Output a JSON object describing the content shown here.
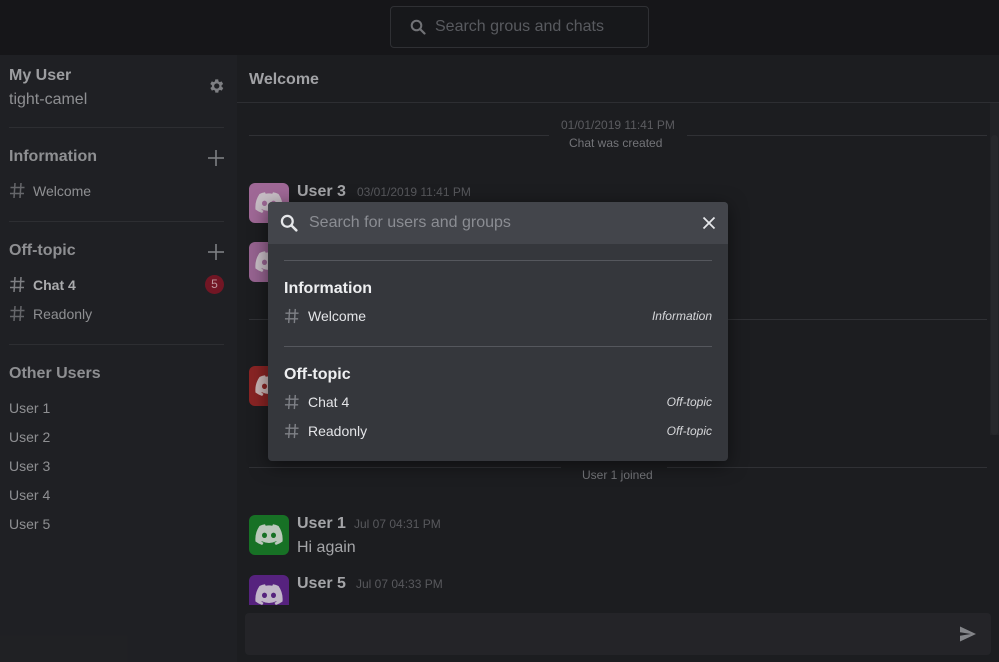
{
  "topbar": {
    "search_placeholder": "Search grous and chats"
  },
  "sidebar": {
    "user_title": "My User",
    "user_name": "tight-camel",
    "groups": [
      {
        "title": "Information",
        "channels": [
          {
            "label": "Welcome"
          }
        ]
      },
      {
        "title": "Off-topic",
        "channels": [
          {
            "label": "Chat 4",
            "unread": "5"
          },
          {
            "label": "Readonly"
          }
        ]
      }
    ],
    "other_users_title": "Other Users",
    "other_users": [
      "User 1",
      "User 2",
      "User 3",
      "User 4",
      "User 5"
    ]
  },
  "main": {
    "title": "Welcome",
    "system_events": [
      {
        "time": "01/01/2019 11:41 PM",
        "text": "Chat was created"
      },
      {
        "text": "User 1 joined"
      }
    ],
    "messages": [
      {
        "user": "User 3",
        "time": "03/01/2019 11:41 PM",
        "avatar_color": "#c27fb8"
      },
      {
        "avatar_color": "#b879b0"
      },
      {
        "avatar_color": "#a82c2c"
      },
      {
        "user": "User 1",
        "time": "Jul 07 04:31 PM",
        "text": "Hi again",
        "avatar_color": "#1d8a2e"
      },
      {
        "user": "User 5",
        "time": "Jul 07 04:33 PM",
        "avatar_color": "#6a2a9a"
      }
    ]
  },
  "modal": {
    "search_placeholder": "Search for users and groups",
    "groups": [
      {
        "title": "Information",
        "items": [
          {
            "label": "Welcome",
            "group": "Information"
          }
        ]
      },
      {
        "title": "Off-topic",
        "items": [
          {
            "label": "Chat 4",
            "group": "Off-topic"
          },
          {
            "label": "Readonly",
            "group": "Off-topic"
          }
        ]
      }
    ]
  },
  "icons": {
    "search": "search-icon",
    "gear": "gear-icon",
    "plus": "plus-icon",
    "hash": "hash-icon",
    "close": "close-icon",
    "send": "send-icon",
    "avatar": "discord-logo-icon"
  }
}
